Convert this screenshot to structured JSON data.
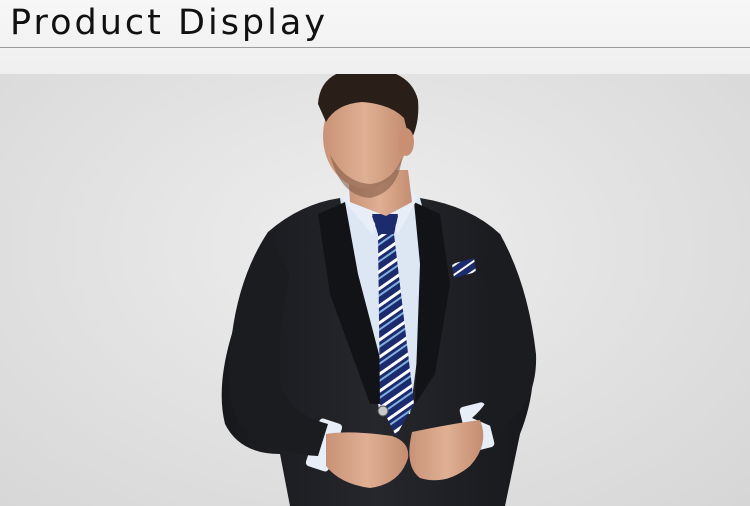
{
  "header": {
    "title": "Product Display"
  },
  "product_image": {
    "subject": "man-in-black-suit-with-striped-blue-tie",
    "colors": {
      "background": "#e4e4e4",
      "suit": "#1d1e22",
      "shirt": "#dde6f3",
      "tie_navy": "#1c2b6e",
      "tie_stripe": "#7fb0e0",
      "skin": "#d9a88a",
      "hair": "#2a1e18"
    }
  }
}
